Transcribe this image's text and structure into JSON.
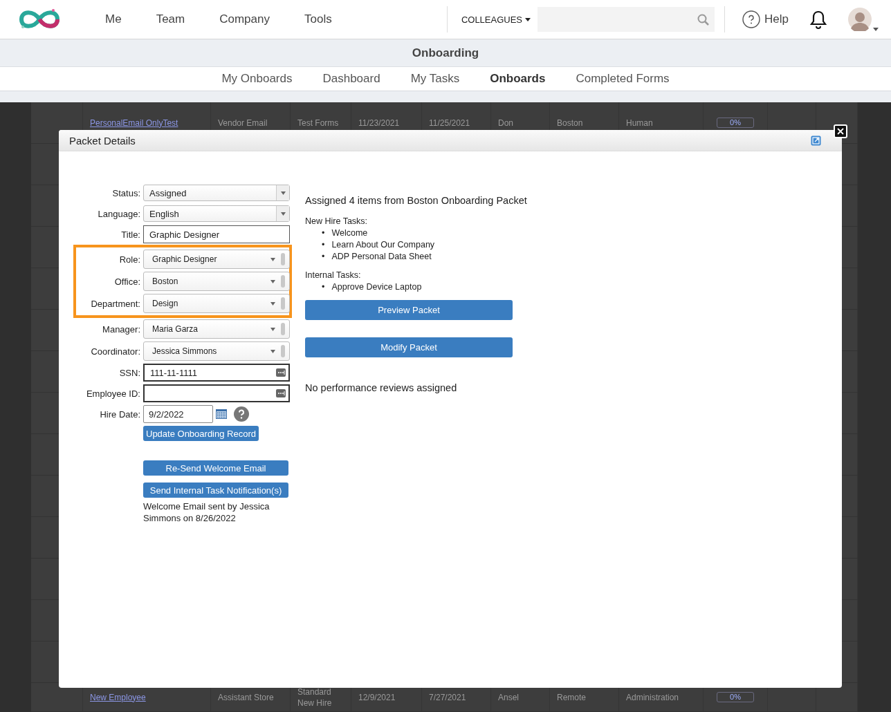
{
  "top_nav": {
    "items": [
      "Me",
      "Team",
      "Company",
      "Tools"
    ],
    "search_scope": "COLLEAGUES",
    "help": "Help"
  },
  "section_title": "Onboarding",
  "sub_tabs": [
    {
      "label": "My Onboards",
      "selected": false
    },
    {
      "label": "Dashboard",
      "selected": false
    },
    {
      "label": "My Tasks",
      "selected": false
    },
    {
      "label": "Onboards",
      "selected": true
    },
    {
      "label": "Completed Forms",
      "selected": false
    }
  ],
  "background_table": {
    "rows": [
      [
        "PersonalEmail OnlyTest",
        "Vendor Email",
        "Test Forms",
        "11/23/2021",
        "11/25/2021",
        "Don",
        "Boston",
        "Human",
        "0%"
      ],
      [
        "New Employee",
        "Assistant Store",
        "Standard New Hire",
        "12/9/2021",
        "7/27/2021",
        "Ansel",
        "Remote",
        "Administration",
        "0%"
      ]
    ]
  },
  "modal": {
    "title": "Packet Details",
    "fields": [
      {
        "label": "Status:",
        "kind": "select",
        "value": "Assigned",
        "highlighted": false
      },
      {
        "label": "Language:",
        "kind": "select",
        "value": "English",
        "highlighted": false
      },
      {
        "label": "Title:",
        "kind": "text",
        "value": "Graphic Designer",
        "highlighted": false
      },
      {
        "label": "Role:",
        "kind": "combo",
        "value": "Graphic Designer",
        "highlighted": true
      },
      {
        "label": "Office:",
        "kind": "combo",
        "value": "Boston",
        "highlighted": true
      },
      {
        "label": "Department:",
        "kind": "combo",
        "value": "Design",
        "highlighted": true
      },
      {
        "label": "Manager:",
        "kind": "combo",
        "value": "Maria Garza",
        "highlighted": false
      },
      {
        "label": "Coordinator:",
        "kind": "combo",
        "value": "Jessica Simmons",
        "highlighted": false
      },
      {
        "label": "SSN:",
        "kind": "masked",
        "value": "111-11-1111",
        "highlighted": false
      },
      {
        "label": "Employee ID:",
        "kind": "masked",
        "highlighted": false
      },
      {
        "label": "Hire Date:",
        "kind": "date",
        "value": "9/2/2022",
        "highlighted": false
      }
    ],
    "update_button": "Update Onboarding Record",
    "resend_button": "Re-Send Welcome Email",
    "notify_button": "Send Internal Task Notification(s)",
    "welcome_note": "Welcome Email sent by Jessica Simmons on 8/26/2022",
    "summary": "Assigned 4 items from Boston Onboarding Packet",
    "bullet": "•",
    "groups": [
      {
        "heading": "New Hire Tasks:",
        "items": [
          "Welcome",
          "Learn About Our Company",
          "ADP Personal Data Sheet"
        ]
      },
      {
        "heading": "Internal Tasks:",
        "items": [
          "Approve Device Laptop"
        ]
      }
    ],
    "preview_button": "Preview Packet",
    "modify_button": "Modify Packet",
    "reviews_note": "No performance reviews assigned"
  }
}
